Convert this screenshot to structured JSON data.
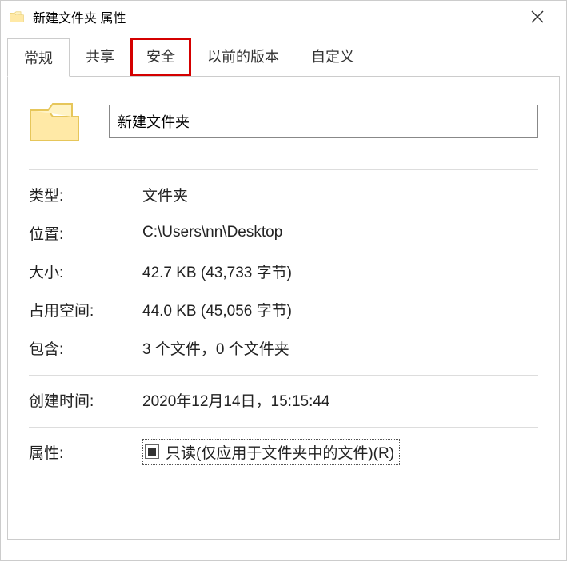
{
  "window": {
    "title": "新建文件夹 属性"
  },
  "tabs": {
    "t0": "常规",
    "t1": "共享",
    "t2": "安全",
    "t3": "以前的版本",
    "t4": "自定义"
  },
  "general": {
    "name_value": "新建文件夹",
    "type_label": "类型:",
    "type_value": "文件夹",
    "location_label": "位置:",
    "location_value": "C:\\Users\\nn\\Desktop",
    "size_label": "大小:",
    "size_value": "42.7 KB (43,733 字节)",
    "sizeondisk_label": "占用空间:",
    "sizeondisk_value": "44.0 KB (45,056 字节)",
    "contains_label": "包含:",
    "contains_value": "3 个文件，0 个文件夹",
    "created_label": "创建时间:",
    "created_value": "2020年12月14日，15:15:44",
    "attributes_label": "属性:",
    "readonly_label": "只读(仅应用于文件夹中的文件)(R)"
  }
}
